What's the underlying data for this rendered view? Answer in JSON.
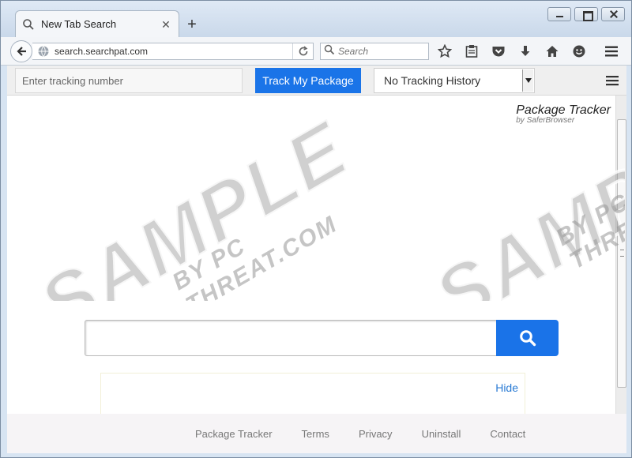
{
  "browser": {
    "tab_title": "New Tab Search",
    "url": "search.searchpat.com",
    "search_placeholder": "Search"
  },
  "extension_toolbar": {
    "tracking_placeholder": "Enter tracking number",
    "track_button_label": "Track My Package",
    "history_selected": "No Tracking History"
  },
  "page": {
    "brand_name": "Package Tracker",
    "brand_sub": "by SaferBrowser",
    "hide_label": "Hide"
  },
  "footer": {
    "links": [
      "Package Tracker",
      "Terms",
      "Privacy",
      "Uninstall",
      "Contact"
    ]
  },
  "watermark": {
    "main": "SAMPLE",
    "sub": "BY PC THREAT.COM"
  },
  "colors": {
    "accent_blue": "#1a74e8",
    "link_blue": "#2a7bd4"
  }
}
